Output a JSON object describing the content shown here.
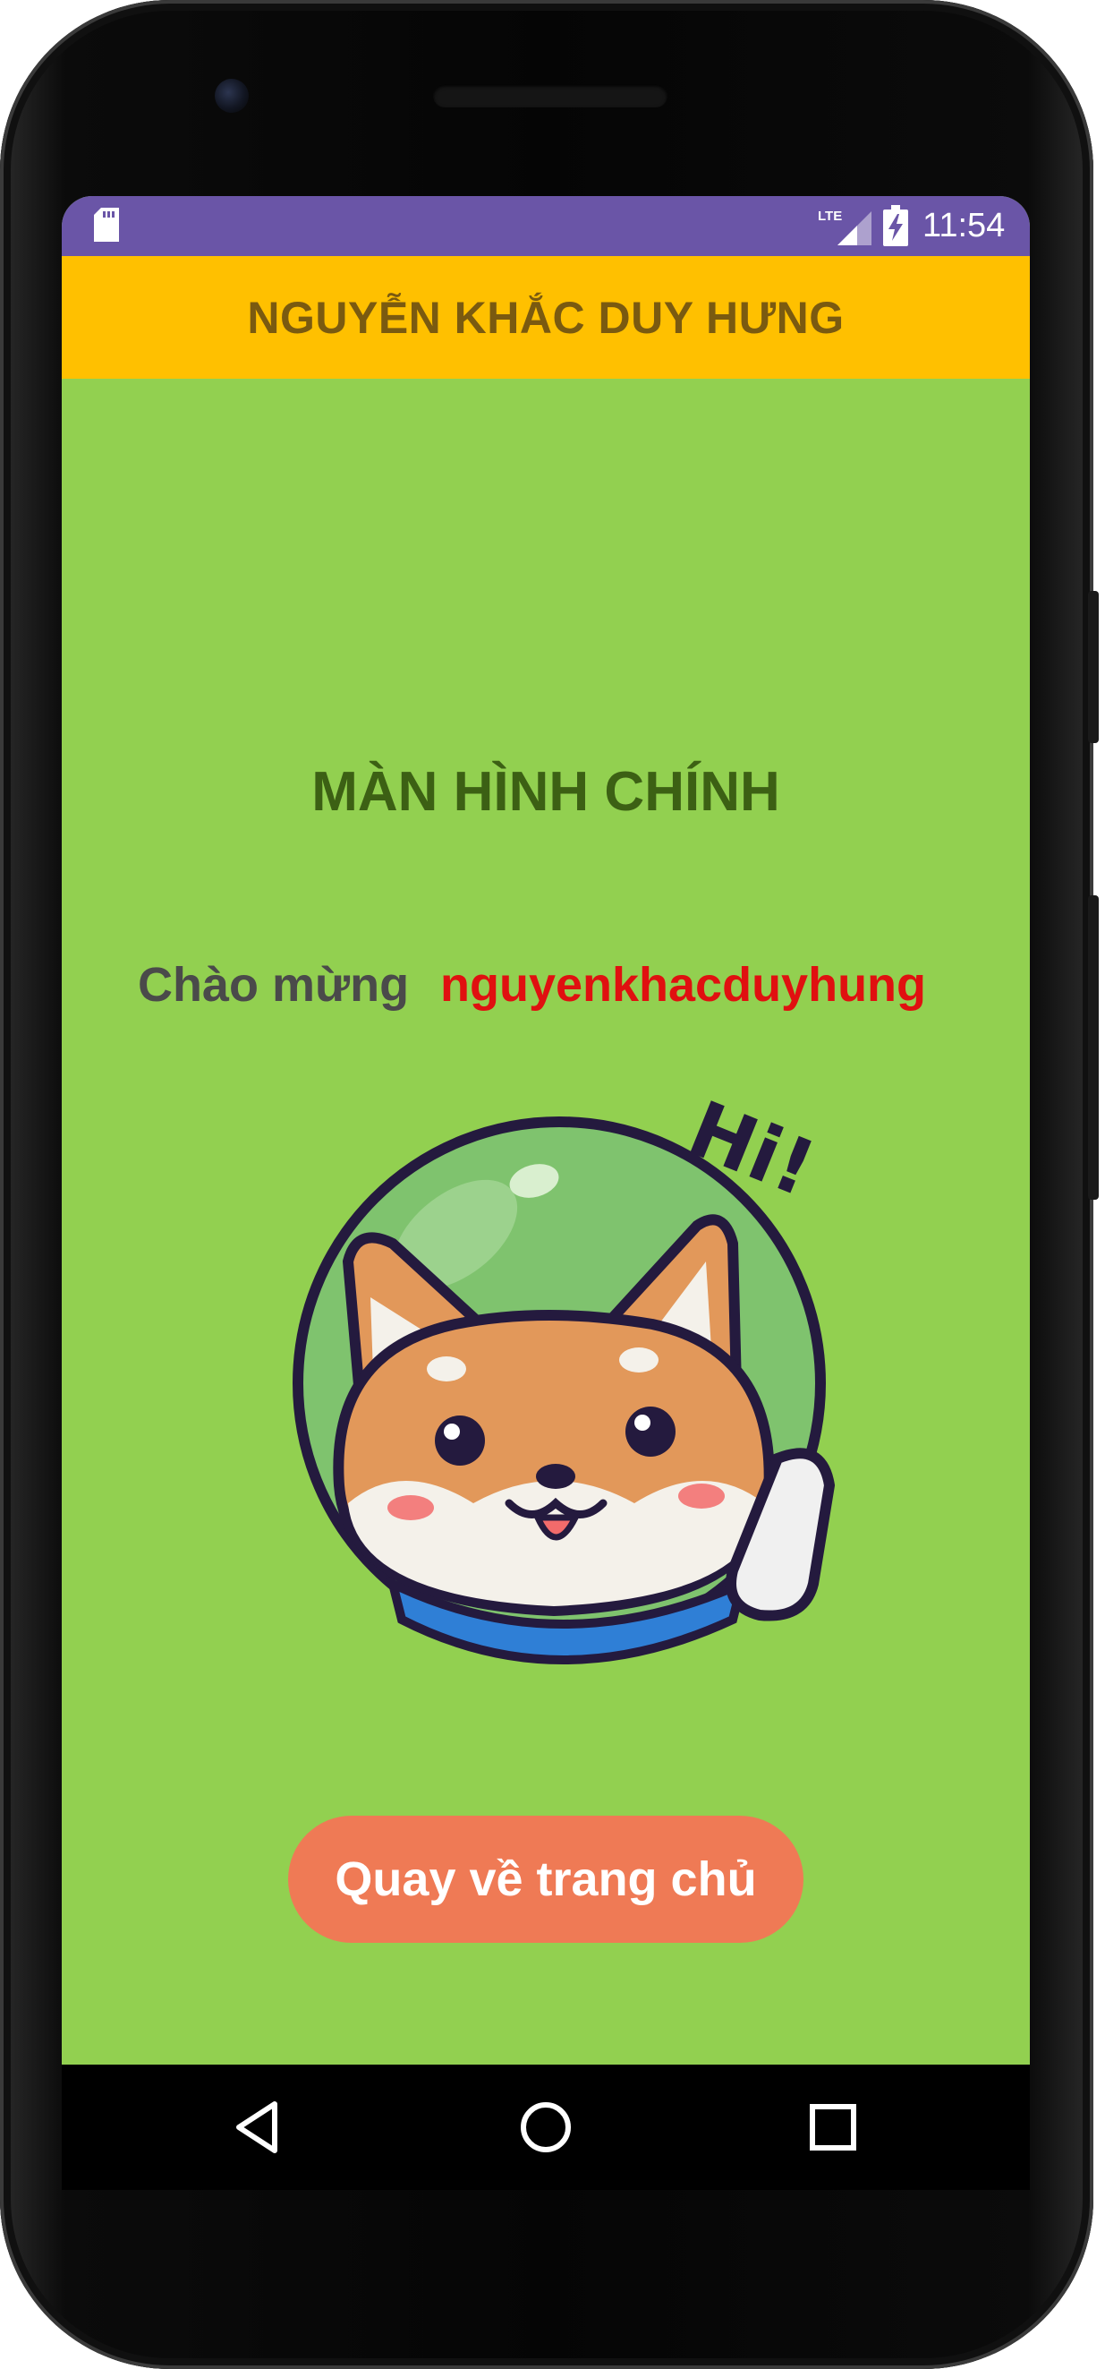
{
  "status_bar": {
    "time": "11:54",
    "network_label": "LTE",
    "icons": [
      "sd-card-icon",
      "lte-signal-icon",
      "battery-charging-icon"
    ],
    "color": "#6a55a7"
  },
  "app_bar": {
    "title": "NGUYỄN KHẮC DUY HƯNG",
    "color": "#ffc000"
  },
  "main": {
    "title": "MÀN HÌNH CHÍNH",
    "welcome_label": "Chào mừng",
    "username": "nguyenkhacduyhung",
    "illustration": {
      "name": "shiba-astronaut-hi-image",
      "text": "Hi!"
    },
    "background": "#92d050"
  },
  "home_button": {
    "label": "Quay về trang chủ",
    "color": "#ef7a55"
  },
  "nav_bar": {
    "buttons": [
      "back-icon",
      "home-icon",
      "recents-icon"
    ]
  }
}
